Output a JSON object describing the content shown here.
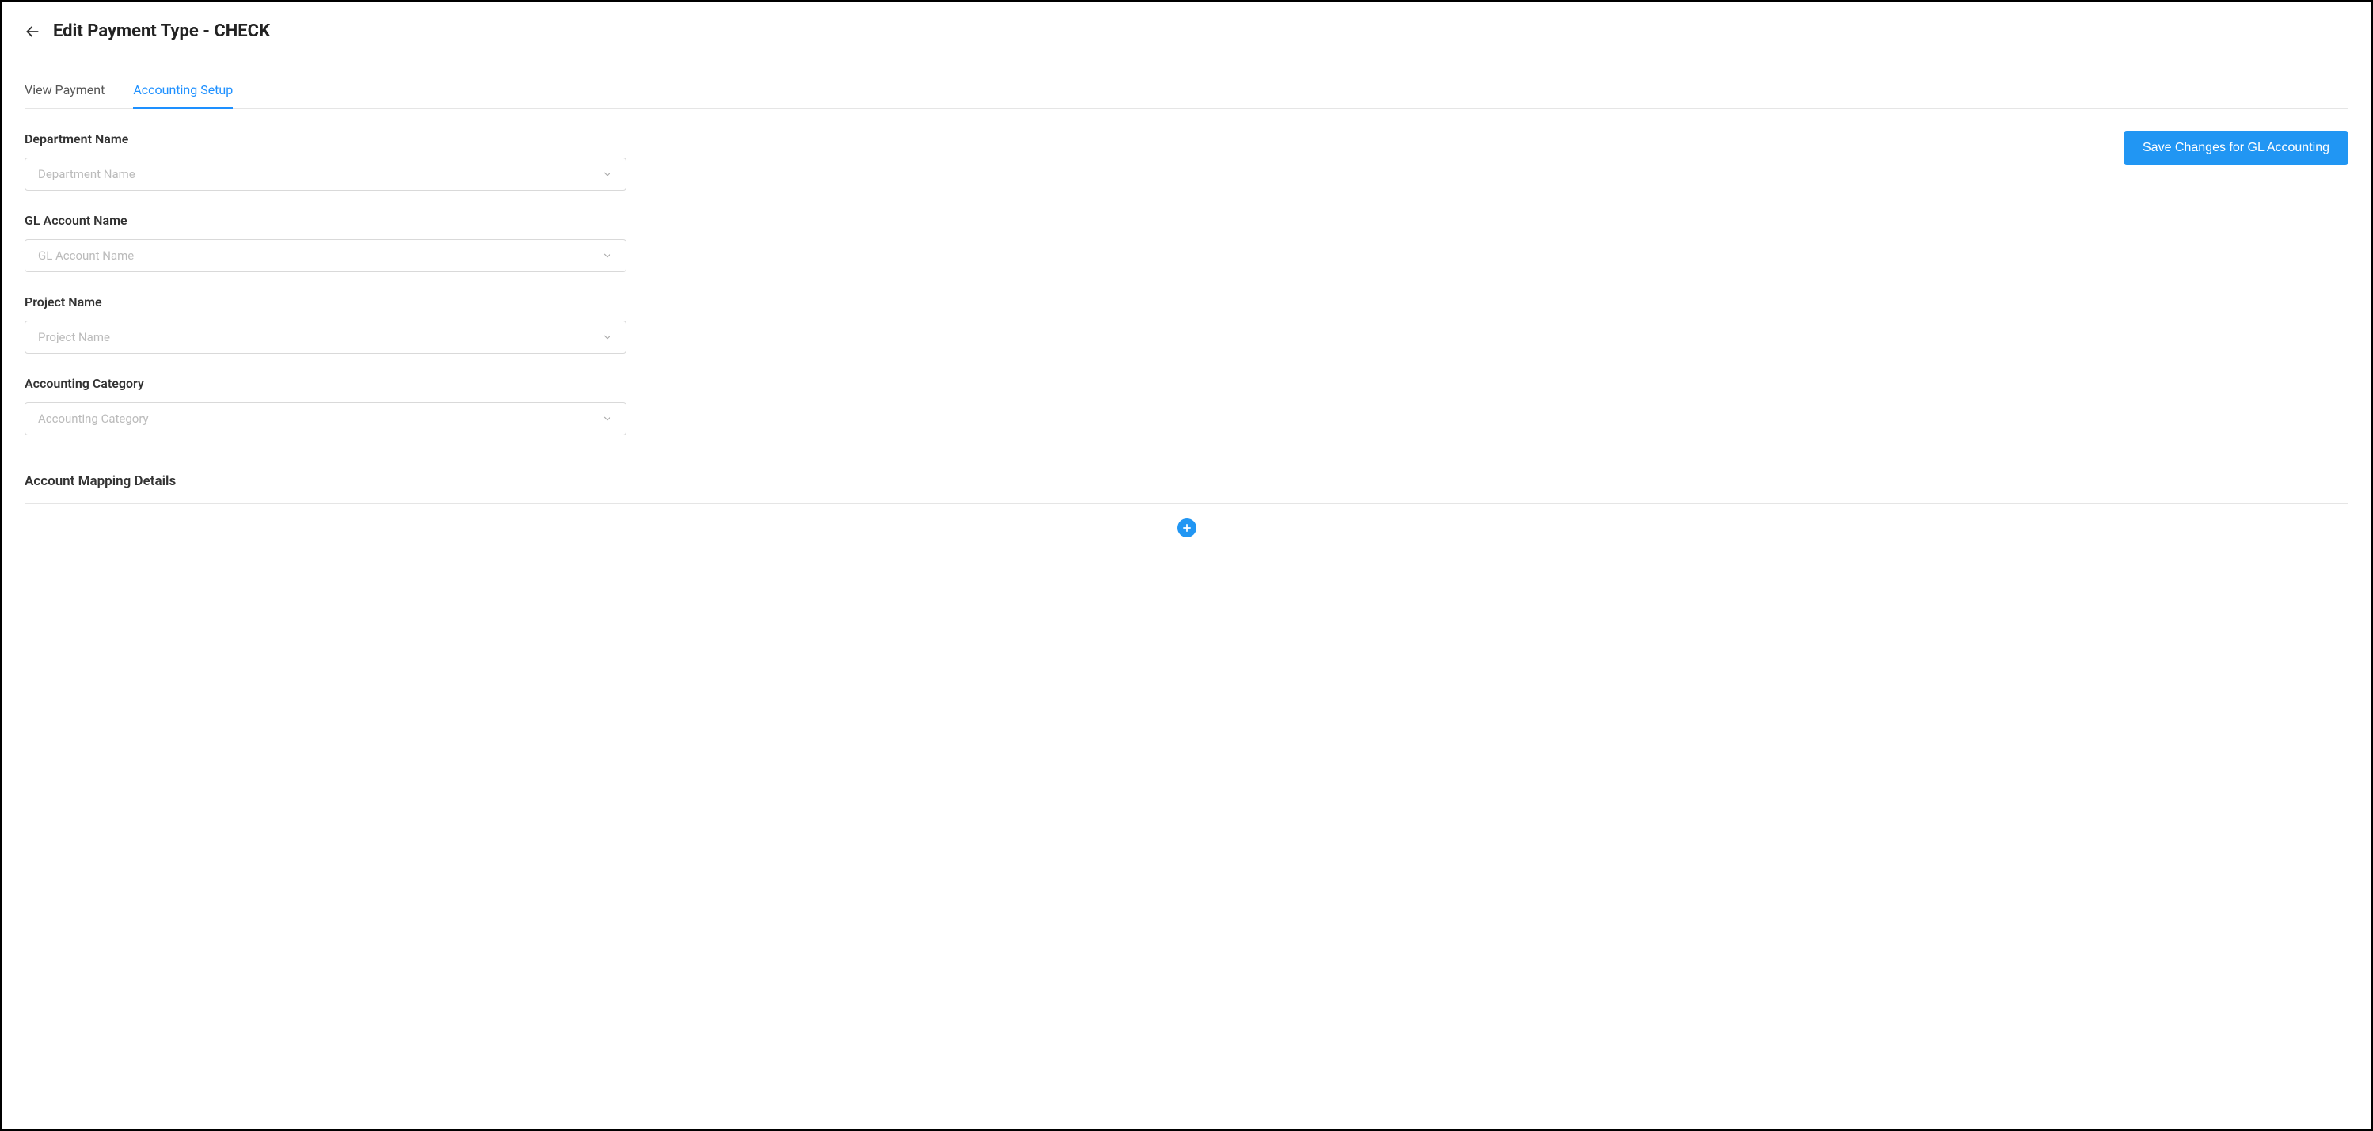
{
  "header": {
    "title": "Edit Payment Type - CHECK"
  },
  "tabs": {
    "view_payment": "View Payment",
    "accounting_setup": "Accounting Setup"
  },
  "actions": {
    "save_label": "Save Changes for GL Accounting"
  },
  "form": {
    "department": {
      "label": "Department Name",
      "placeholder": "Department Name"
    },
    "gl_account": {
      "label": "GL Account Name",
      "placeholder": "GL Account Name"
    },
    "project": {
      "label": "Project Name",
      "placeholder": "Project Name"
    },
    "accounting_category": {
      "label": "Accounting Category",
      "placeholder": "Accounting Category"
    }
  },
  "mapping": {
    "title": "Account Mapping Details"
  }
}
